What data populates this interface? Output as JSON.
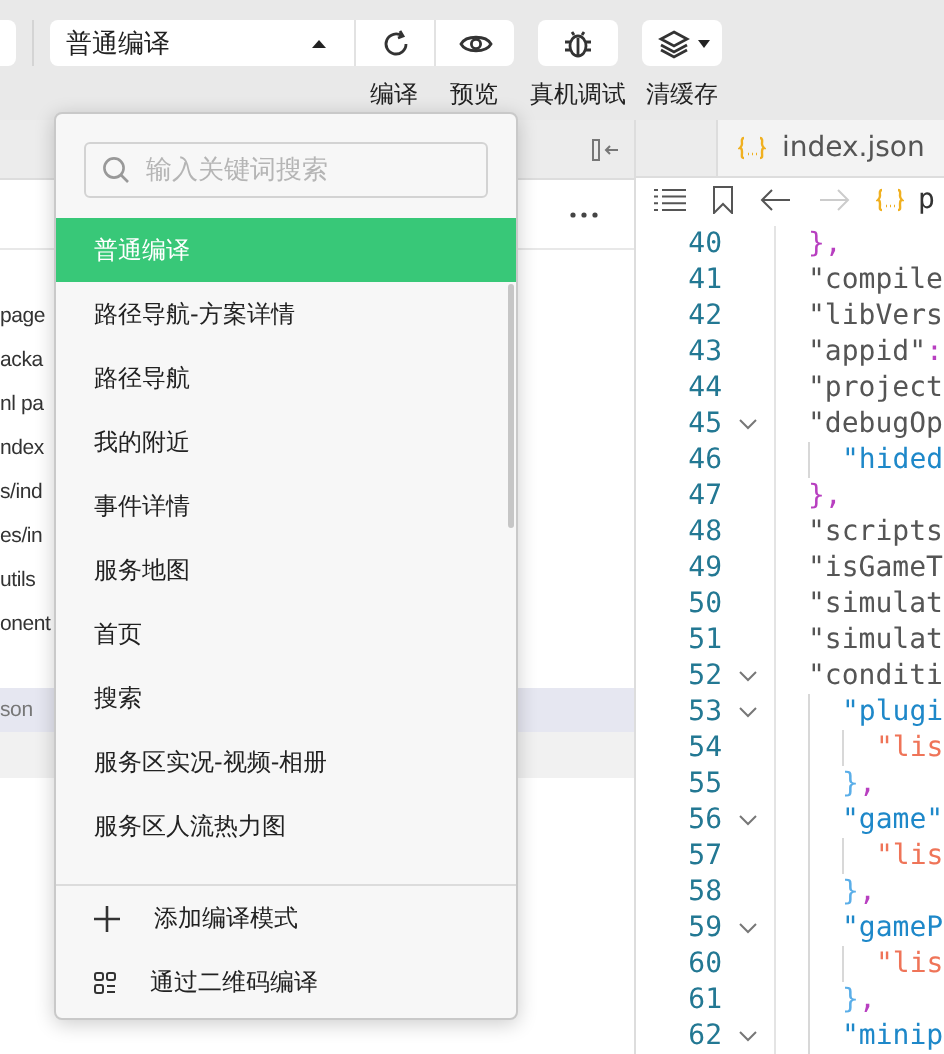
{
  "toolbar": {
    "compile_mode": "普通编译",
    "buttons": [
      {
        "label": "编译",
        "kind": "compile"
      },
      {
        "label": "预览",
        "kind": "preview"
      },
      {
        "label": "真机调试",
        "kind": "debug"
      },
      {
        "label": "清缓存",
        "kind": "cache"
      }
    ]
  },
  "file_tree": {
    "rows": [
      {
        "label": "page",
        "selected": false
      },
      {
        "label": "acka",
        "selected": false
      },
      {
        "label": "nl pa",
        "selected": false
      },
      {
        "label": "ndex",
        "selected": false
      },
      {
        "label": "s/ind",
        "selected": false
      },
      {
        "label": "es/in",
        "selected": false
      },
      {
        "label": "utils",
        "selected": false
      },
      {
        "label": "onent",
        "selected": false
      },
      {
        "label": "son",
        "selected": true
      }
    ]
  },
  "compile_menu": {
    "search": {
      "placeholder": "输入关键词搜索"
    },
    "items": [
      {
        "label": "普通编译",
        "selected": true
      },
      {
        "label": "路径导航-方案详情",
        "selected": false
      },
      {
        "label": "路径导航",
        "selected": false
      },
      {
        "label": "我的附近",
        "selected": false
      },
      {
        "label": "事件详情",
        "selected": false
      },
      {
        "label": "服务地图",
        "selected": false
      },
      {
        "label": "首页",
        "selected": false
      },
      {
        "label": "搜索",
        "selected": false
      },
      {
        "label": "服务区实况-视频-相册",
        "selected": false
      },
      {
        "label": "服务区人流热力图",
        "selected": false
      }
    ],
    "actions": [
      {
        "label": "添加编译模式",
        "kind": "add"
      },
      {
        "label": "通过二维码编译",
        "kind": "qr"
      }
    ]
  },
  "editor": {
    "tab": "index.json",
    "breadcrumb": "p",
    "lines": [
      {
        "number": "40",
        "tokens": [
          {
            "text": "},",
            "kind": "punct"
          }
        ]
      },
      {
        "number": "41",
        "tokens": [
          {
            "text": "\"compile",
            "kind": "key"
          }
        ]
      },
      {
        "number": "42",
        "tokens": [
          {
            "text": "\"libVers",
            "kind": "key"
          }
        ]
      },
      {
        "number": "43",
        "tokens": [
          {
            "text": "\"appid\"",
            "kind": "key"
          },
          {
            "text": ":",
            "kind": "punct"
          }
        ]
      },
      {
        "number": "44",
        "tokens": [
          {
            "text": "\"project",
            "kind": "key"
          }
        ]
      },
      {
        "number": "45",
        "expanded": true,
        "tokens": [
          {
            "text": "\"debugOp",
            "kind": "key"
          }
        ]
      },
      {
        "number": "46",
        "tokens": [
          {
            "kind": "guide"
          },
          {
            "text": "\"hided",
            "kind": "prop"
          }
        ]
      },
      {
        "number": "47",
        "tokens": [
          {
            "text": "},",
            "kind": "punct"
          }
        ]
      },
      {
        "number": "48",
        "tokens": [
          {
            "text": "\"scripts",
            "kind": "key"
          }
        ]
      },
      {
        "number": "49",
        "tokens": [
          {
            "text": "\"isGameT",
            "kind": "key"
          }
        ]
      },
      {
        "number": "50",
        "tokens": [
          {
            "text": "\"simulat",
            "kind": "key"
          }
        ]
      },
      {
        "number": "51",
        "tokens": [
          {
            "text": "\"simulat",
            "kind": "key"
          }
        ]
      },
      {
        "number": "52",
        "expanded": true,
        "tokens": [
          {
            "text": "\"conditi",
            "kind": "key"
          }
        ]
      },
      {
        "number": "53",
        "expanded": true,
        "tokens": [
          {
            "kind": "guide"
          },
          {
            "text": "\"plugi",
            "kind": "prop"
          }
        ]
      },
      {
        "number": "54",
        "tokens": [
          {
            "kind": "guide"
          },
          {
            "kind": "guide"
          },
          {
            "text": "\"lis",
            "kind": "string"
          }
        ]
      },
      {
        "number": "55",
        "tokens": [
          {
            "kind": "guide"
          },
          {
            "text": "}",
            "kind": "bracket"
          },
          {
            "text": ",",
            "kind": "punct"
          }
        ]
      },
      {
        "number": "56",
        "expanded": true,
        "tokens": [
          {
            "kind": "guide"
          },
          {
            "text": "\"game\"",
            "kind": "prop"
          }
        ]
      },
      {
        "number": "57",
        "tokens": [
          {
            "kind": "guide"
          },
          {
            "kind": "guide"
          },
          {
            "text": "\"lis",
            "kind": "string"
          }
        ]
      },
      {
        "number": "58",
        "tokens": [
          {
            "kind": "guide"
          },
          {
            "text": "}",
            "kind": "bracket"
          },
          {
            "text": ",",
            "kind": "punct"
          }
        ]
      },
      {
        "number": "59",
        "expanded": true,
        "tokens": [
          {
            "kind": "guide"
          },
          {
            "text": "\"gameP",
            "kind": "prop"
          }
        ]
      },
      {
        "number": "60",
        "tokens": [
          {
            "kind": "guide"
          },
          {
            "kind": "guide"
          },
          {
            "text": "\"lis",
            "kind": "string"
          }
        ]
      },
      {
        "number": "61",
        "tokens": [
          {
            "kind": "guide"
          },
          {
            "text": "}",
            "kind": "bracket"
          },
          {
            "text": ",",
            "kind": "punct"
          }
        ]
      },
      {
        "number": "62",
        "expanded": true,
        "tokens": [
          {
            "kind": "guide"
          },
          {
            "text": "\"minip",
            "kind": "prop"
          }
        ]
      }
    ]
  }
}
